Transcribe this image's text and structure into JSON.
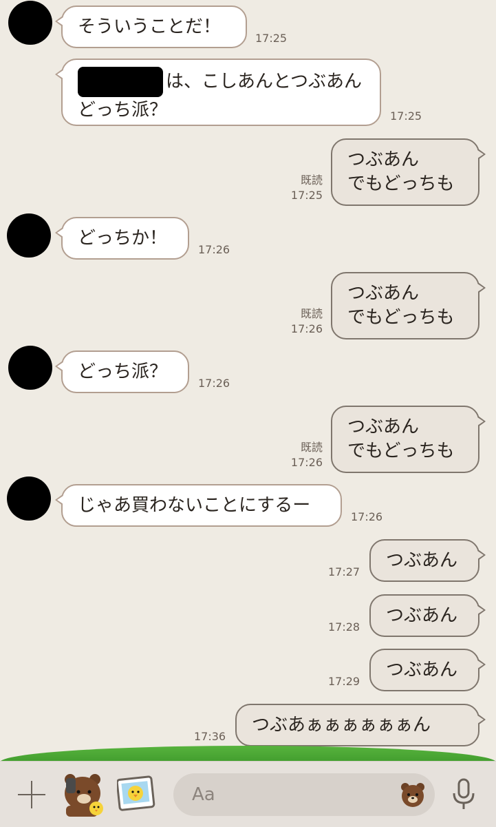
{
  "messages": [
    {
      "side": "in",
      "text": "そういうことだ！",
      "time": "17:25"
    },
    {
      "side": "in",
      "text_line1": "は、こしあんとつぶあん",
      "text_line2": "どっち派？",
      "time": "17:25"
    },
    {
      "side": "out",
      "text_line1": "つぶあん",
      "text_line2": "でもどっちも",
      "read": "既読",
      "time": "17:25"
    },
    {
      "side": "in",
      "text": "どっちか！",
      "time": "17:26"
    },
    {
      "side": "out",
      "text_line1": "つぶあん",
      "text_line2": "でもどっちも",
      "read": "既読",
      "time": "17:26"
    },
    {
      "side": "in",
      "text": "どっち派？",
      "time": "17:26"
    },
    {
      "side": "out",
      "text_line1": "つぶあん",
      "text_line2": "でもどっちも",
      "read": "既読",
      "time": "17:26"
    },
    {
      "side": "in",
      "text": "じゃあ買わないことにするー",
      "time": "17:26"
    },
    {
      "side": "out",
      "text": "つぶあん",
      "time": "17:27"
    },
    {
      "side": "out",
      "text": "つぶあん",
      "time": "17:28"
    },
    {
      "side": "out",
      "text": "つぶあん",
      "time": "17:29"
    },
    {
      "side": "out",
      "text": "つぶあぁぁぁぁぁぁん",
      "time": "17:36"
    }
  ],
  "composer": {
    "placeholder": "Aa"
  },
  "icons": {
    "plus": "plus-icon",
    "sticker": "sticker-icon",
    "photo": "photo-icon",
    "emoji": "emoji-icon",
    "mic": "microphone-icon"
  },
  "colors": {
    "background": "#efebe3",
    "incoming_bubble": "#ffffff",
    "outgoing_bubble": "#eae4dc",
    "grass": "#4da935"
  }
}
